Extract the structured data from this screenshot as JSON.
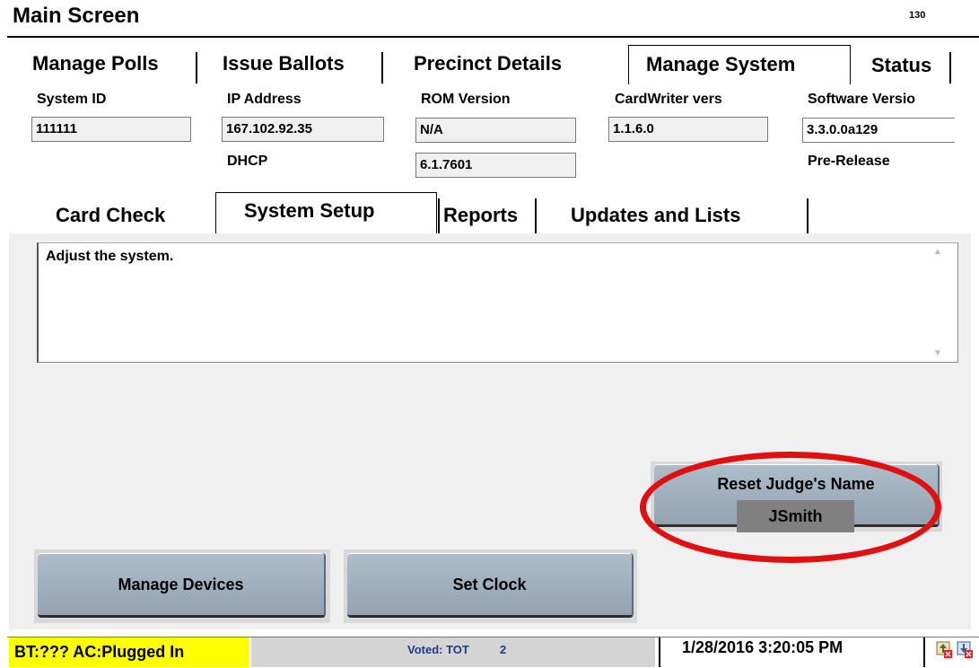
{
  "header": {
    "title": "Main Screen",
    "screen_number": "130"
  },
  "main_tabs": [
    {
      "label": "Manage Polls"
    },
    {
      "label": "Issue Ballots"
    },
    {
      "label": "Precinct Details"
    },
    {
      "label": "Manage System",
      "active": true
    },
    {
      "label": "Status"
    }
  ],
  "system_info": {
    "system_id": {
      "label": "System ID",
      "value": "111111"
    },
    "ip_address": {
      "label": "IP Address",
      "value": "167.102.92.35",
      "sub_label": "DHCP"
    },
    "rom_version": {
      "label": "ROM Version",
      "value": "N/A",
      "value2": "6.1.7601"
    },
    "cardwriter": {
      "label": "CardWriter vers",
      "value": "1.1.6.0"
    },
    "software": {
      "label": "Software Versio",
      "value": "3.3.0.0a129",
      "sub_label": "Pre-Release"
    }
  },
  "sub_tabs": [
    {
      "label": "Card Check"
    },
    {
      "label": "System Setup",
      "active": true
    },
    {
      "label": "Reports"
    },
    {
      "label": "Updates and Lists"
    }
  ],
  "panel": {
    "description": "Adjust the system.",
    "reset_judge_button": "Reset Judge's Name",
    "judge_name": "JSmith",
    "manage_devices_button": "Manage Devices",
    "set_clock_button": "Set Clock"
  },
  "status_bar": {
    "power": "BT:??? AC:Plugged In",
    "voted_label": "Voted:  TOT",
    "voted_count": "2",
    "datetime": "1/28/2016 3:20:05 PM"
  },
  "colors": {
    "power_bg": "#ffff00",
    "voted_text": "#1a3d8c",
    "highlight_oval": "#e01010",
    "button_fill": "#a1b0be"
  },
  "icons": [
    "upload-error-icon",
    "download-error-icon"
  ]
}
